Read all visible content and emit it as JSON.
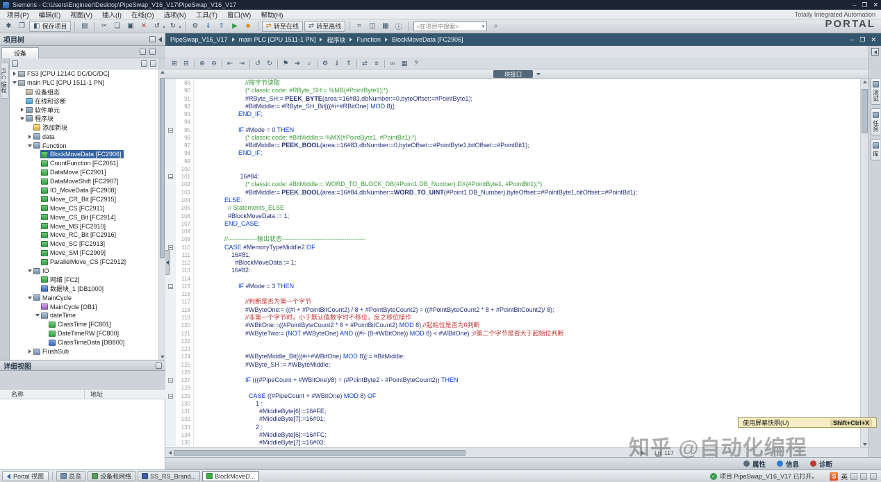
{
  "glyphs": {
    "dropdown": "▾"
  },
  "title_bar": {
    "app_title": "Siemens - C:\\Users\\Engineer\\Desktop\\PipeSwap_V16_V17\\PipeSwap_V16_V17",
    "window_buttons": [
      "–",
      "❐",
      "✕"
    ]
  },
  "menu_bar": [
    "项目(P)",
    "编辑(E)",
    "视图(V)",
    "插入(I)",
    "在线(O)",
    "选项(N)",
    "工具(T)",
    "窗口(W)",
    "帮助(H)"
  ],
  "toolbar": {
    "search_value": "<在项目中搜索>",
    "brand1": "Totally Integrated Automation",
    "brand2": "PORTAL",
    "items": [
      {
        "n": "new-project-icon",
        "g": "✱"
      },
      {
        "n": "open-project-icon",
        "g": "❐"
      },
      {
        "n": "save-project-button",
        "g": "◧",
        "label": "保存项目"
      },
      "|",
      {
        "n": "print-icon",
        "g": "▤"
      },
      "|",
      {
        "n": "cut-icon",
        "g": "✂"
      },
      {
        "n": "copy-icon",
        "g": "❏"
      },
      {
        "n": "paste-icon",
        "g": "▣"
      },
      {
        "n": "delete-icon",
        "g": "✕",
        "c": "#b03a2e"
      },
      {
        "n": "undo-icon",
        "g": "↺",
        "dd": 1
      },
      {
        "n": "redo-icon",
        "g": "↻",
        "dd": 1
      },
      "|",
      {
        "n": "compile-icon",
        "g": "⚙"
      },
      {
        "n": "download-to-device-icon",
        "g": "⇓",
        "c": "#2a6fb8"
      },
      {
        "n": "upload-from-device-icon",
        "g": "⇑",
        "c": "#2a6fb8"
      },
      {
        "n": "start-cpu-icon",
        "g": "▶",
        "c": "#2e9e44"
      },
      {
        "n": "stop-cpu-icon",
        "g": "■",
        "c": "#d98a1d"
      },
      "|",
      {
        "n": "go-online-button",
        "g": "⇄",
        "label": "转至在线",
        "c": "#d98a1d"
      },
      {
        "n": "go-offline-button",
        "g": "⇄",
        "label": "转至离线",
        "c": "#5a6b7a"
      },
      "|",
      {
        "n": "accessible-devices-icon",
        "g": "⌗"
      },
      {
        "n": "start-simulation-icon",
        "g": "◫"
      },
      {
        "n": "cross-references-icon",
        "g": "▦"
      },
      {
        "n": "project-info-icon",
        "g": "ⓘ"
      },
      "|",
      {
        "n": "search-project-input",
        "search": 1
      },
      {
        "n": "search-binoculars-icon",
        "g": "⌕"
      }
    ]
  },
  "breadcrumb": {
    "items": [
      "PipeSwap_V16_V17",
      "main PLC [CPU 1511-1 PN]",
      "程序块",
      "Function",
      "BlockMoveData [FC2906]"
    ],
    "window_buttons": [
      "–",
      "❐",
      "✕"
    ]
  },
  "left_strip_label": "PLC 编程",
  "project_tree": {
    "title": "项目树",
    "device_tab": "设备",
    "items": [
      {
        "label": "FS3 [CPU 1214C DC/DC/DC]",
        "lvl": 0,
        "icon": "plc",
        "exp": "closed"
      },
      {
        "label": "main PLC [CPU 1511-1 PN]",
        "lvl": 0,
        "icon": "plc",
        "exp": "open"
      },
      {
        "label": "设备组态",
        "lvl": 1,
        "icon": "devcfg"
      },
      {
        "label": "在线和诊断",
        "lvl": 1,
        "icon": "diag"
      },
      {
        "label": "软件单元",
        "lvl": 1,
        "icon": "folder",
        "exp": "closed"
      },
      {
        "label": "程序块",
        "lvl": 1,
        "icon": "folder",
        "exp": "open"
      },
      {
        "label": "添加新块",
        "lvl": 2,
        "icon": "add"
      },
      {
        "label": "data",
        "lvl": 2,
        "icon": "folder",
        "exp": "closed"
      },
      {
        "label": "Function",
        "lvl": 2,
        "icon": "folder",
        "exp": "open"
      },
      {
        "label": "BlockMoveData [FC2906]",
        "lvl": 3,
        "icon": "fc",
        "sel": true
      },
      {
        "label": "CountFunction [FC2061]",
        "lvl": 3,
        "icon": "fc"
      },
      {
        "label": "DataMove [FC2901]",
        "lvl": 3,
        "icon": "fc"
      },
      {
        "label": "DataMoveShift [FC2907]",
        "lvl": 3,
        "icon": "fc"
      },
      {
        "label": "IO_MoveData [FC2908]",
        "lvl": 3,
        "icon": "fc"
      },
      {
        "label": "Move_CR_Bit [FC2915]",
        "lvl": 3,
        "icon": "fc"
      },
      {
        "label": "Move_CS [FC2911]",
        "lvl": 3,
        "icon": "fc"
      },
      {
        "label": "Move_CS_Bit [FC2914]",
        "lvl": 3,
        "icon": "fc"
      },
      {
        "label": "Move_MS [FC2910]",
        "lvl": 3,
        "icon": "fc"
      },
      {
        "label": "Move_RC_Bit [FC2916]",
        "lvl": 3,
        "icon": "fc"
      },
      {
        "label": "Move_SC [FC2913]",
        "lvl": 3,
        "icon": "fc"
      },
      {
        "label": "Move_SM [FC2909]",
        "lvl": 3,
        "icon": "fc"
      },
      {
        "label": "ParallelMove_CS [FC2912]",
        "lvl": 3,
        "icon": "fc"
      },
      {
        "label": "IO",
        "lvl": 2,
        "icon": "folder",
        "exp": "open"
      },
      {
        "label": "网络 [FC2]",
        "lvl": 3,
        "icon": "fc"
      },
      {
        "label": "数据块_1 [DB1000]",
        "lvl": 3,
        "icon": "db"
      },
      {
        "label": "MainCycle",
        "lvl": 2,
        "icon": "folder",
        "exp": "open"
      },
      {
        "label": "MainCycle [OB1]",
        "lvl": 3,
        "icon": "ob"
      },
      {
        "label": "dateTime",
        "lvl": 3,
        "icon": "folder",
        "exp": "open"
      },
      {
        "label": "ClassTime [FC801]",
        "lvl": 4,
        "icon": "fc"
      },
      {
        "label": "DateTimeRW [FC800]",
        "lvl": 4,
        "icon": "fc"
      },
      {
        "label": "ClassTimeData [DB800]",
        "lvl": 4,
        "icon": "db"
      },
      {
        "label": "FlushSub",
        "lvl": 2,
        "icon": "folder",
        "exp": "closed"
      }
    ]
  },
  "details_view": {
    "title": "详细视图",
    "columns": [
      "名称",
      "地址"
    ]
  },
  "editor": {
    "interface_label": "块接口",
    "status_line": "Ln: 117",
    "toolbar": [
      {
        "n": "expand-all-icon",
        "g": "⊞"
      },
      {
        "n": "collapse-all-icon",
        "g": "⊟"
      },
      "|",
      {
        "n": "insert-row-icon",
        "g": "⊕"
      },
      {
        "n": "delete-row-icon",
        "g": "⊖"
      },
      "|",
      {
        "n": "outdent-icon",
        "g": "⇤"
      },
      {
        "n": "indent-icon",
        "g": "⇥"
      },
      "|",
      {
        "n": "undo-icon",
        "g": "↺"
      },
      {
        "n": "redo-icon",
        "g": "↻"
      },
      "|",
      {
        "n": "bookmark-icon",
        "g": "⚑"
      },
      {
        "n": "goto-icon",
        "g": "➔"
      },
      {
        "n": "find-icon",
        "g": "⌕"
      },
      "|",
      {
        "n": "compile-icon",
        "g": "⚙"
      },
      {
        "n": "download-icon",
        "g": "⇓"
      },
      {
        "n": "upload-icon",
        "g": "⇑"
      },
      "|",
      {
        "n": "update-call-icon",
        "g": "⇄"
      },
      {
        "n": "call-structure-icon",
        "g": "≡"
      },
      "|",
      {
        "n": "monitor-glasses-icon",
        "g": "∞"
      },
      {
        "n": "snapshot-icon",
        "g": "▦"
      },
      {
        "n": "help-icon",
        "g": "?"
      }
    ],
    "code_lines": [
      [
        89,
        28,
        [
          [
            "//按字节读取",
            "c"
          ]
        ]
      ],
      [
        90,
        28,
        [
          [
            "(* classic code: #RByte_SH:= %MB(#PointByte1);*)",
            "c"
          ]
        ]
      ],
      [
        91,
        28,
        [
          [
            "#RByte_SH:= ",
            "p"
          ],
          [
            "PEEK_BYTE",
            "f"
          ],
          [
            "(area:=16#83,dbNumber:=0,byteOffset:=#PointByte1);",
            "p"
          ]
        ]
      ],
      [
        92,
        28,
        [
          [
            "#BitMiddle:= #RByte_SH_Bit[((#i+#RBitOne) ",
            "p"
          ],
          [
            "MOD",
            "k"
          ],
          [
            " 8)];",
            "p"
          ]
        ]
      ],
      [
        93,
        24,
        [
          [
            "END_IF;",
            "k"
          ]
        ]
      ],
      [
        94,
        0,
        []
      ],
      [
        95,
        24,
        [
          [
            "IF",
            "k"
          ],
          [
            " #Mode = 0 ",
            "p"
          ],
          [
            "THEN",
            "k"
          ]
        ],
        1
      ],
      [
        96,
        28,
        [
          [
            "(* classic code: #BitMiddle:= %MX(#PointByte1, #PointBit1);*)",
            "c"
          ]
        ]
      ],
      [
        97,
        28,
        [
          [
            "#BitMiddle:= ",
            "p"
          ],
          [
            "PEEK_BOOL",
            "f"
          ],
          [
            "(area:=16#83,dbNumber:=0,byteOffset:=#PointByte1,bitOffset:=#PointBit1);",
            "p"
          ]
        ]
      ],
      [
        98,
        24,
        [
          [
            "END_IF;",
            "k"
          ]
        ]
      ],
      [
        99,
        0,
        []
      ],
      [
        100,
        0,
        []
      ],
      [
        101,
        25,
        [
          [
            "16#84:",
            "p"
          ]
        ],
        1
      ],
      [
        102,
        28,
        [
          [
            "(* classic code: #BitMiddle:= WORD_TO_BLOCK_DB(#Point1.DB_Number).DX(#PointByte1, #PointBit1);*)",
            "c"
          ]
        ]
      ],
      [
        103,
        28,
        [
          [
            "#BitMiddle:= ",
            "p"
          ],
          [
            "PEEK_BOOL",
            "f"
          ],
          [
            "(area:=16#84,dbNumber:=",
            "p"
          ],
          [
            "WORD_TO_UINT",
            "f"
          ],
          [
            "(#Point1.DB_Number),byteOffset:=#PointByte1,bitOffset:=#PointBit1);",
            "p"
          ]
        ]
      ],
      [
        104,
        16,
        [
          [
            "ELSE",
            "k"
          ],
          [
            ":",
            "p"
          ]
        ]
      ],
      [
        105,
        18,
        [
          [
            "// Statements_ELSE",
            "c"
          ]
        ]
      ],
      [
        106,
        18,
        [
          [
            "#BlockMoveData := 1;",
            "p"
          ]
        ]
      ],
      [
        107,
        16,
        [
          [
            "END_CASE;",
            "k"
          ]
        ]
      ],
      [
        108,
        0,
        []
      ],
      [
        109,
        16,
        [
          [
            "//--------------输出状态----------------------------------------",
            "c"
          ]
        ]
      ],
      [
        110,
        16,
        [
          [
            "CASE",
            "k"
          ],
          [
            " #MemoryTypeMiddle2 ",
            "p"
          ],
          [
            "OF",
            "k"
          ]
        ],
        1
      ],
      [
        111,
        20,
        [
          [
            "16#81:",
            "p"
          ]
        ]
      ],
      [
        112,
        22,
        [
          [
            "#BlockMoveData := 1;",
            "p"
          ]
        ]
      ],
      [
        113,
        20,
        [
          [
            "16#82:",
            "p"
          ]
        ]
      ],
      [
        114,
        0,
        []
      ],
      [
        115,
        24,
        [
          [
            "IF",
            "k"
          ],
          [
            " #Mode = 3 ",
            "p"
          ],
          [
            "THEN",
            "k"
          ]
        ],
        1
      ],
      [
        116,
        0,
        []
      ],
      [
        117,
        28,
        [
          [
            "//判断是否为第一个字节",
            "e"
          ]
        ]
      ],
      [
        118,
        28,
        [
          [
            "#WByteOne:= ((#i + #PointBitCount2) / 8 + #PointByteCount2) = ((#PointByteCount2 * 8 + #PointBitCount2)/ 8);",
            "p"
          ]
        ]
      ],
      [
        119,
        28,
        [
          [
            "//非第一个字节时，小于默认值数字时不移位，反之移位操作",
            "e"
          ]
        ]
      ],
      [
        120,
        28,
        [
          [
            "#WBitOne:=((#PointByteCount2 * 8 + #PointBitCount2) ",
            "p"
          ],
          [
            "MOD",
            "k"
          ],
          [
            " 8);",
            "p"
          ],
          [
            "//起始位是否为0判断",
            "e"
          ]
        ]
      ],
      [
        121,
        28,
        [
          [
            "#WByteTwo:= (",
            "p"
          ],
          [
            "NOT",
            "k"
          ],
          [
            " #WByteOne) ",
            "p"
          ],
          [
            "AND",
            "k"
          ],
          [
            " ((#i- (8-#WBitOne)) ",
            "p"
          ],
          [
            "MOD",
            "k"
          ],
          [
            " 8) < #WBitOne) ;",
            "p"
          ],
          [
            "//第二个字节是否大于起始位判断",
            "e"
          ]
        ]
      ],
      [
        122,
        0,
        []
      ],
      [
        123,
        0,
        []
      ],
      [
        124,
        28,
        [
          [
            "#WByteMiddle_Bit[((#i+#WBitOne) ",
            "p"
          ],
          [
            "MOD",
            "k"
          ],
          [
            " 8)]:= #BitMiddle;",
            "p"
          ]
        ]
      ],
      [
        125,
        28,
        [
          [
            "#WByte_SH := #WByteMiddle;",
            "p"
          ]
        ]
      ],
      [
        126,
        0,
        []
      ],
      [
        127,
        28,
        [
          [
            "IF",
            "k"
          ],
          [
            " (((#PipeCount + #WBitOne)/8) = (#PointByte2 - #PointByteCount2)) ",
            "p"
          ],
          [
            "THEN",
            "k"
          ]
        ],
        1
      ],
      [
        128,
        0,
        []
      ],
      [
        129,
        30,
        [
          [
            "CASE",
            "k"
          ],
          [
            " ((#PipeCount + #WBitOne) ",
            "p"
          ],
          [
            "MOD",
            "k"
          ],
          [
            " 8) ",
            "p"
          ],
          [
            "OF",
            "k"
          ]
        ],
        1
      ],
      [
        130,
        34,
        [
          [
            "1 :",
            "p"
          ]
        ]
      ],
      [
        131,
        36,
        [
          [
            "#MiddleByte[6]:=16#FE;",
            "p"
          ]
        ]
      ],
      [
        132,
        36,
        [
          [
            "#MiddleByte[7]:=16#01;",
            "p"
          ]
        ]
      ],
      [
        133,
        34,
        [
          [
            "2 :",
            "p"
          ]
        ]
      ],
      [
        134,
        36,
        [
          [
            "#MiddleByte[6]:=16#FC;",
            "p"
          ]
        ]
      ],
      [
        135,
        36,
        [
          [
            "#MiddleByte[7]:=16#03;",
            "p"
          ]
        ]
      ]
    ]
  },
  "task_cards": [
    {
      "label": "测试",
      "name": "task-card-testing"
    },
    {
      "label": "任务",
      "name": "task-card-tasks"
    },
    {
      "label": "库",
      "name": "task-card-libraries"
    }
  ],
  "inspector_tabs": [
    {
      "id": "properties",
      "label": "属性",
      "color": "#5a6b7a"
    },
    {
      "id": "info",
      "label": "信息",
      "color": "#2d7dd2"
    },
    {
      "id": "diagnostics",
      "label": "诊断",
      "color": "#c0392b"
    }
  ],
  "status_bar": {
    "portal_button": "Portal 视图",
    "tabs": [
      {
        "label": "总览",
        "ic": "#7490ad"
      },
      {
        "label": "设备和网络",
        "ic": "#58a05a"
      },
      {
        "label": "SS_RS_Brand...",
        "ic": "#3a5fae"
      },
      {
        "label": "BlockMoveD...",
        "ic": "#3fae49",
        "active": true
      }
    ],
    "message": "项目 PipeSwap_V16_V17 已打开。",
    "check_glyph": "✓",
    "ime_logo": "S",
    "ime_lang": "英"
  },
  "overlay": {
    "tooltip_label": "使用屏幕快照(U)",
    "tooltip_shortcut": "Shift+Ctrl+X",
    "watermark": "知乎 @自动化编程"
  }
}
